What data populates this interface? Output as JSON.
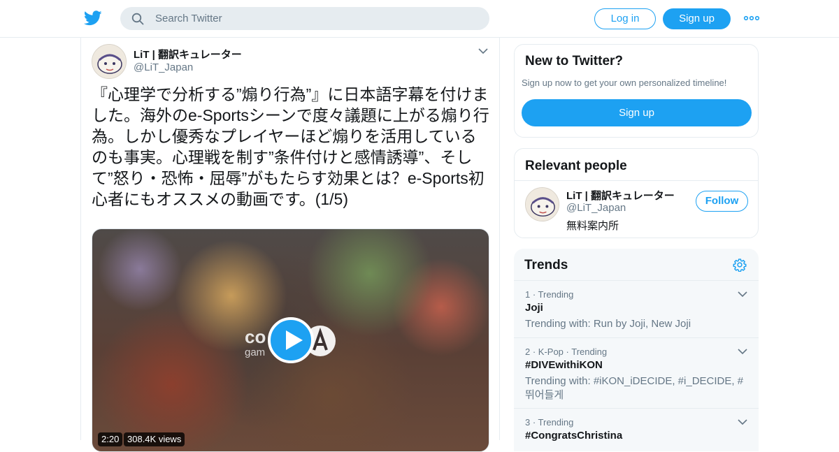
{
  "header": {
    "search_placeholder": "Search Twitter",
    "login_label": "Log in",
    "signup_label": "Sign up",
    "brand_color": "#1da1f2"
  },
  "tweet": {
    "author_name": "LiT | 翻訳キュレーター",
    "author_handle": "@LiT_Japan",
    "text": "『心理学で分析する”煽り行為”』に日本語字幕を付けました。海外のe-Sportsシーンで度々議題に上がる煽り行為。しかし優秀なプレイヤーほど煽りを活用しているのも事実。心理戦を制す”条件付けと感情誘導”、そして”怒り・恐怖・屈辱”がもたらす効果とは？e-Sports初心者にもオススメの動画です。(1/5)",
    "media": {
      "duration": "2:20",
      "views": "308.4K views",
      "logo_text_top": "co",
      "logo_text_bottom": "gam"
    }
  },
  "sidebar": {
    "new_to_twitter": {
      "title": "New to Twitter?",
      "subtitle": "Sign up now to get your own personalized timeline!",
      "button_label": "Sign up"
    },
    "relevant_people": {
      "title": "Relevant people",
      "person": {
        "name": "LiT | 翻訳キュレーター",
        "handle": "@LiT_Japan",
        "bio": "無料案内所",
        "follow_label": "Follow"
      }
    },
    "trends": {
      "title": "Trends",
      "items": [
        {
          "meta": "1 · Trending",
          "name": "Joji",
          "with": "Trending with: Run by Joji, New Joji"
        },
        {
          "meta": "2 · K-Pop · Trending",
          "name": "#DIVEwithiKON",
          "with": "Trending with: #iKON_iDECIDE, #i_DECIDE, #뛰어들게"
        },
        {
          "meta": "3 · Trending",
          "name": "#CongratsChristina",
          "with": ""
        }
      ]
    }
  }
}
